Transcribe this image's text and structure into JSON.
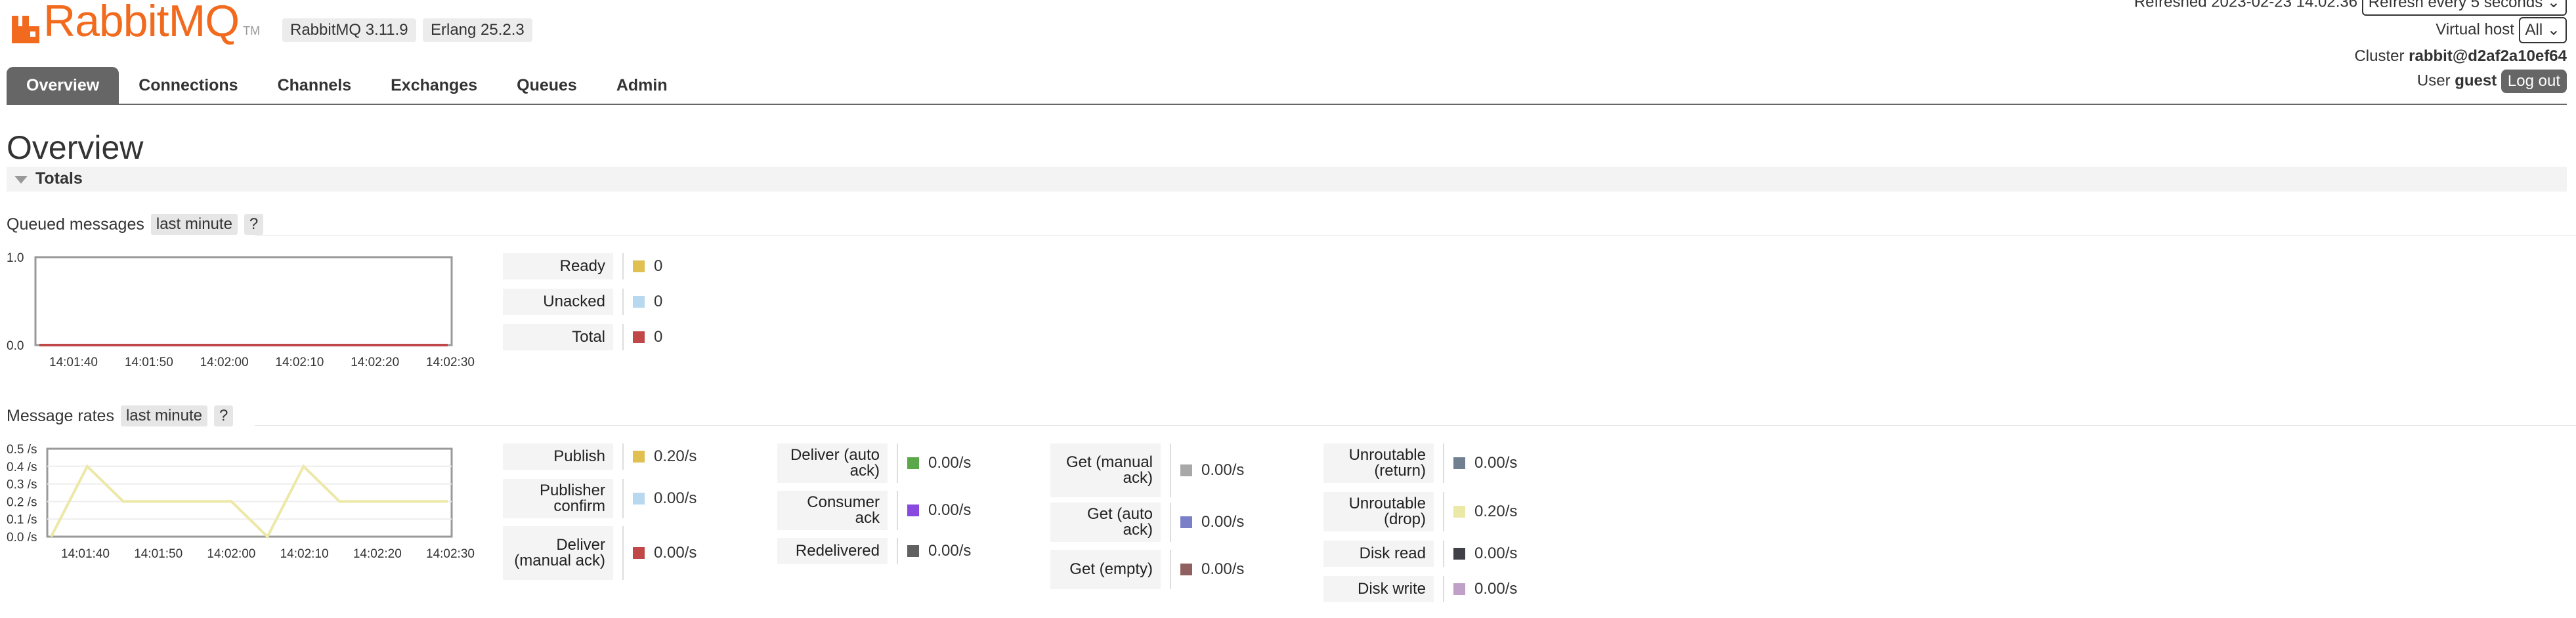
{
  "header": {
    "logo_text": "RabbitMQ",
    "logo_tm": "TM",
    "rabbitmq_version": "RabbitMQ 3.11.9",
    "erlang_version": "Erlang 25.2.3",
    "refreshed_text": "Refreshed 2023-02-23 14:02:36",
    "refresh_select": "Refresh every 5 seconds",
    "virtual_host_label": "Virtual host",
    "virtual_host_value": "All",
    "cluster_label": "Cluster",
    "cluster_value": "rabbit@d2af2a10ef64",
    "user_label": "User",
    "user_value": "guest",
    "logout_label": "Log out",
    "brand_color": "#f26a1e"
  },
  "tabs": [
    {
      "label": "Overview",
      "active": true
    },
    {
      "label": "Connections",
      "active": false
    },
    {
      "label": "Channels",
      "active": false
    },
    {
      "label": "Exchanges",
      "active": false
    },
    {
      "label": "Queues",
      "active": false
    },
    {
      "label": "Admin",
      "active": false
    }
  ],
  "page": {
    "title": "Overview",
    "totals_label": "Totals",
    "queued_label": "Queued messages",
    "queued_period": "last minute",
    "help": "?",
    "rates_label": "Message rates",
    "rates_period": "last minute"
  },
  "queued_legend": [
    {
      "label": "Ready",
      "value": "0",
      "color": "#e0c050"
    },
    {
      "label": "Unacked",
      "value": "0",
      "color": "#b8d8f0"
    },
    {
      "label": "Total",
      "value": "0",
      "color": "#c04848"
    }
  ],
  "rates_legend": {
    "col1": [
      {
        "label": "Publish",
        "value": "0.20/s",
        "color": "#e0c050"
      },
      {
        "label": "Publisher confirm",
        "value": "0.00/s",
        "color": "#b8d8f0"
      },
      {
        "label": "Deliver (manual ack)",
        "value": "0.00/s",
        "color": "#c04848"
      }
    ],
    "col2": [
      {
        "label": "Deliver (auto ack)",
        "value": "0.00/s",
        "color": "#5aa84a"
      },
      {
        "label": "Consumer ack",
        "value": "0.00/s",
        "color": "#8a4ae0"
      },
      {
        "label": "Redelivered",
        "value": "0.00/s",
        "color": "#606060"
      }
    ],
    "col3": [
      {
        "label": "Get (manual ack)",
        "value": "0.00/s",
        "color": "#a8a8a8"
      },
      {
        "label": "Get (auto ack)",
        "value": "0.00/s",
        "color": "#7a80c8"
      },
      {
        "label": "Get (empty)",
        "value": "0.00/s",
        "color": "#906060"
      }
    ],
    "col4": [
      {
        "label": "Unroutable (return)",
        "value": "0.00/s",
        "color": "#708090"
      },
      {
        "label": "Unroutable (drop)",
        "value": "0.20/s",
        "color": "#ece8a8"
      },
      {
        "label": "Disk read",
        "value": "0.00/s",
        "color": "#404048"
      },
      {
        "label": "Disk write",
        "value": "0.00/s",
        "color": "#c0a0c8"
      }
    ]
  },
  "chart_data": [
    {
      "type": "line",
      "title": "Queued messages",
      "x": [
        "14:01:40",
        "14:01:50",
        "14:02:00",
        "14:02:10",
        "14:02:20",
        "14:02:30"
      ],
      "y_ticks": [
        "1.0",
        "0.0"
      ],
      "ylim": [
        0,
        1
      ],
      "series": [
        {
          "name": "Ready",
          "color": "#e0c050",
          "values": [
            0,
            0,
            0,
            0,
            0,
            0
          ]
        },
        {
          "name": "Unacked",
          "color": "#b8d8f0",
          "values": [
            0,
            0,
            0,
            0,
            0,
            0
          ]
        },
        {
          "name": "Total",
          "color": "#c04848",
          "values": [
            0,
            0,
            0,
            0,
            0,
            0
          ]
        }
      ]
    },
    {
      "type": "line",
      "title": "Message rates",
      "x": [
        "14:01:40",
        "14:01:50",
        "14:02:00",
        "14:02:10",
        "14:02:20",
        "14:02:30"
      ],
      "y_ticks": [
        "0.5 /s",
        "0.4 /s",
        "0.3 /s",
        "0.2 /s",
        "0.1 /s",
        "0.0 /s"
      ],
      "ylim": [
        0,
        0.5
      ],
      "series": [
        {
          "name": "Unroutable (drop)",
          "color": "#ece8a8",
          "values": [
            0.0,
            0.4,
            0.2,
            0.2,
            0.2,
            0.2,
            0.0,
            0.4,
            0.2,
            0.2,
            0.2,
            0.2
          ]
        }
      ]
    }
  ]
}
